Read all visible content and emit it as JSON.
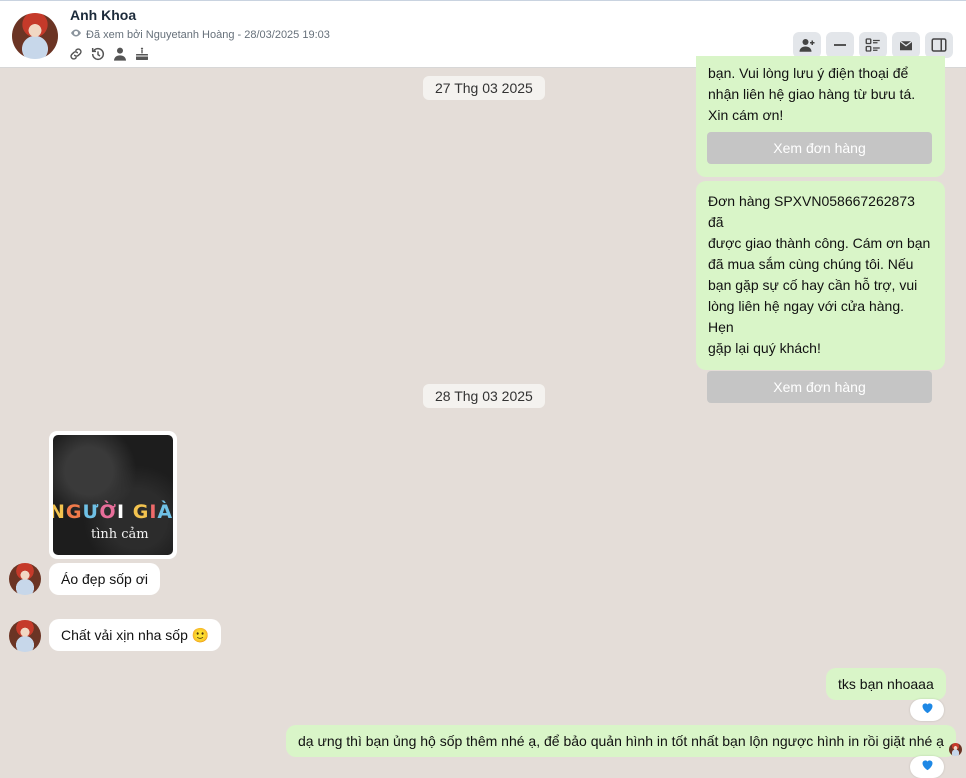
{
  "header": {
    "name": "Anh Khoa",
    "seen_text": "Đã xem bởi Nguyetanh Hoàng - 28/03/2025 19:03"
  },
  "messages": {
    "order_partial": "bạn. Vui lòng lưu ý điện thoại để nhận liên hệ giao hàng từ bưu tá. Xin cám ơn!",
    "order_partial_lines": [
      "bạn. Vui lòng lưu ý điện thoại để",
      "nhận liên hệ giao hàng từ bưu tá.",
      "Xin cám ơn!"
    ],
    "view_order_label": "Xem đơn hàng",
    "order_delivered_lines": [
      "Đơn hàng SPXVN058667262873 đã",
      "được giao thành công. Cám ơn bạn",
      "đã mua sắm cùng chúng tôi. Nếu",
      "bạn gặp sự cố hay cần hỗ trợ, vui",
      "lòng liên hệ ngay với cửa hàng. Hẹn",
      "gặp lại quý khách!"
    ],
    "date1": "27 Thg 03 2025",
    "date2": "28 Thg 03 2025",
    "photo_text_main": "NGƯỜI GIÀ",
    "photo_text_sub": "tình cảm",
    "in1": "Áo đẹp sốp ơi",
    "in2": "Chất vải xịn nha sốp 🙂",
    "out1": "tks bạn nhoaaa",
    "out2": "dạ ưng thì bạn ủng hộ sốp thêm nhé ạ, để bảo quản hình in tốt nhất bạn lộn ngược hình in rồi giặt nhé ạ"
  },
  "colors": {
    "background": "#e4ddd8",
    "outgoing": "#d9f5c8",
    "incoming": "#ffffff",
    "heart": "#1e88e5"
  }
}
